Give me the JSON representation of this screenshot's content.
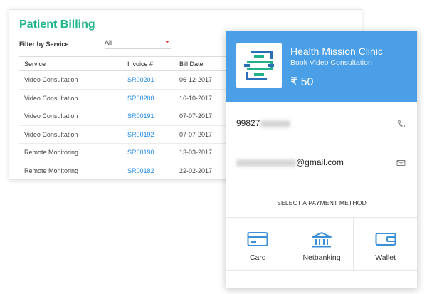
{
  "billing": {
    "title": "Patient Billing",
    "filter_label": "Filter by Service",
    "filter_value": "All",
    "columns": [
      "Service",
      "Invoice #",
      "Bill Date"
    ],
    "rows": [
      {
        "service": "Video Consultation",
        "invoice": "SR00201",
        "date": "06-12-2017"
      },
      {
        "service": "Video Consultation",
        "invoice": "SR00200",
        "date": "16-10-2017"
      },
      {
        "service": "Video Consultation",
        "invoice": "SR00191",
        "date": "07-07-2017"
      },
      {
        "service": "Video Consultation",
        "invoice": "SR00192",
        "date": "07-07-2017"
      },
      {
        "service": "Remote Monitoring",
        "invoice": "SR00190",
        "date": "13-03-2017"
      },
      {
        "service": "Remote Monitoring",
        "invoice": "SR00182",
        "date": "22-02-2017"
      }
    ]
  },
  "payment": {
    "clinic_name": "Health Mission Clinic",
    "subtitle": "Book Video Consultation",
    "price": "₹ 50",
    "phone_prefix": "99827",
    "email_suffix": "@gmail.com",
    "method_title": "SELECT A PAYMENT METHOD",
    "methods": [
      {
        "label": "Card",
        "icon": "card-icon"
      },
      {
        "label": "Netbanking",
        "icon": "bank-icon"
      },
      {
        "label": "Wallet",
        "icon": "wallet-icon"
      }
    ],
    "colors": {
      "header": "#4a9fe7",
      "icon": "#3d8fd6",
      "title_green": "#21b58a",
      "invoice_link": "#1e88e5"
    }
  }
}
